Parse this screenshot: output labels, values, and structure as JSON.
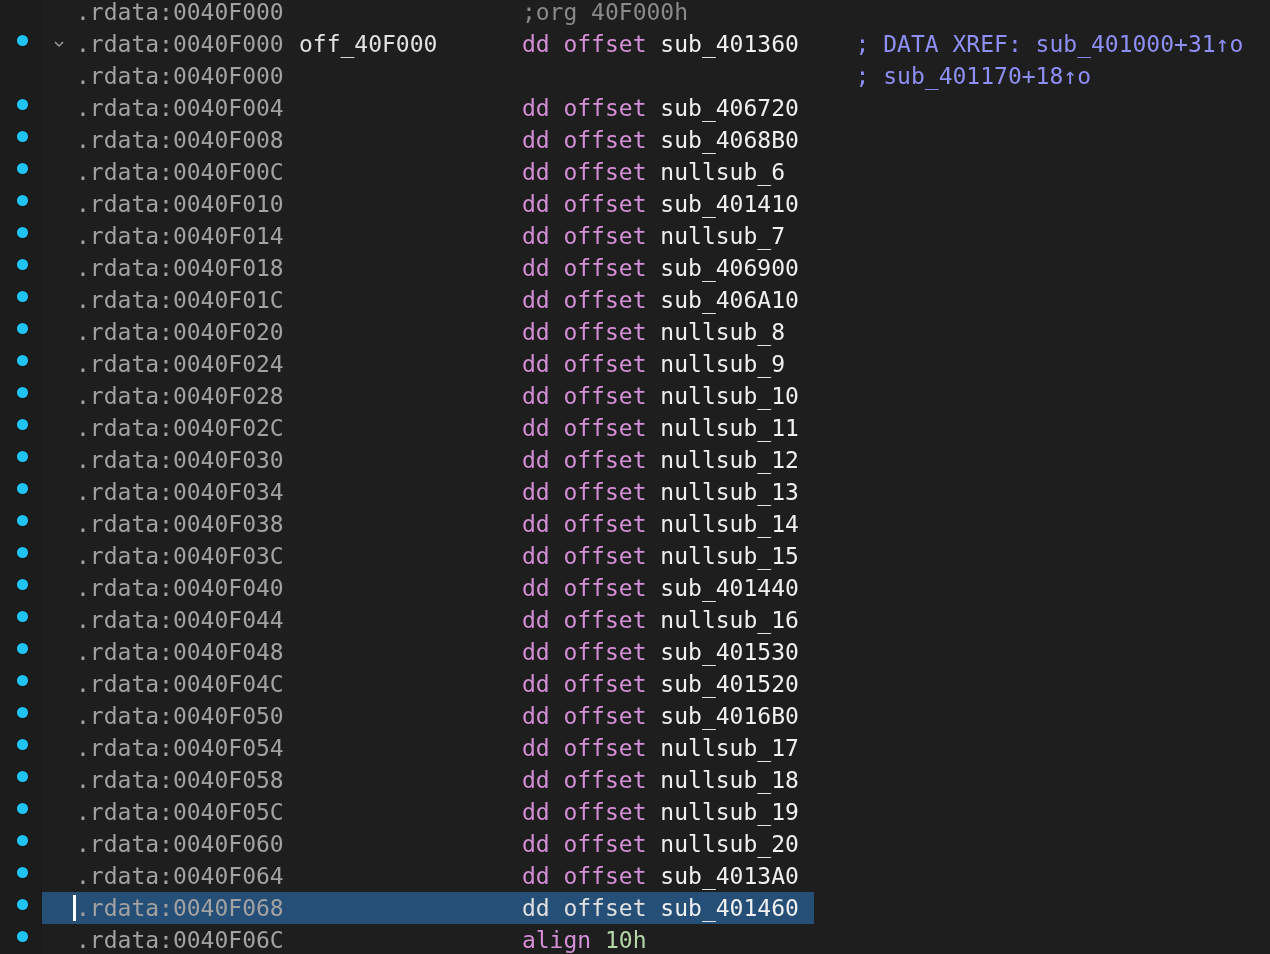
{
  "rows": [
    {
      "address": ".rdata:0040F000",
      "marked": false,
      "selected": false,
      "code": [
        {
          "kind": "directive",
          "text": ";org 40F000h"
        }
      ]
    },
    {
      "address": ".rdata:0040F000",
      "label": "off_40F000",
      "expanded": true,
      "marked": true,
      "selected": false,
      "code": [
        {
          "kind": "keyword",
          "text": "dd"
        },
        {
          "kind": "keyword",
          "text": "offset"
        },
        {
          "kind": "name",
          "text": "sub_401360"
        }
      ],
      "comment": "; DATA XREF: sub_401000+31↑o"
    },
    {
      "address": ".rdata:0040F000",
      "marked": false,
      "selected": false,
      "code": [],
      "comment": "; sub_401170+18↑o"
    },
    {
      "address": ".rdata:0040F004",
      "marked": true,
      "selected": false,
      "code": [
        {
          "kind": "keyword",
          "text": "dd"
        },
        {
          "kind": "keyword",
          "text": "offset"
        },
        {
          "kind": "name",
          "text": "sub_406720"
        }
      ]
    },
    {
      "address": ".rdata:0040F008",
      "marked": true,
      "selected": false,
      "code": [
        {
          "kind": "keyword",
          "text": "dd"
        },
        {
          "kind": "keyword",
          "text": "offset"
        },
        {
          "kind": "name",
          "text": "sub_4068B0"
        }
      ]
    },
    {
      "address": ".rdata:0040F00C",
      "marked": true,
      "selected": false,
      "code": [
        {
          "kind": "keyword",
          "text": "dd"
        },
        {
          "kind": "keyword",
          "text": "offset"
        },
        {
          "kind": "name",
          "text": "nullsub_6"
        }
      ]
    },
    {
      "address": ".rdata:0040F010",
      "marked": true,
      "selected": false,
      "code": [
        {
          "kind": "keyword",
          "text": "dd"
        },
        {
          "kind": "keyword",
          "text": "offset"
        },
        {
          "kind": "name",
          "text": "sub_401410"
        }
      ]
    },
    {
      "address": ".rdata:0040F014",
      "marked": true,
      "selected": false,
      "code": [
        {
          "kind": "keyword",
          "text": "dd"
        },
        {
          "kind": "keyword",
          "text": "offset"
        },
        {
          "kind": "name",
          "text": "nullsub_7"
        }
      ]
    },
    {
      "address": ".rdata:0040F018",
      "marked": true,
      "selected": false,
      "code": [
        {
          "kind": "keyword",
          "text": "dd"
        },
        {
          "kind": "keyword",
          "text": "offset"
        },
        {
          "kind": "name",
          "text": "sub_406900"
        }
      ]
    },
    {
      "address": ".rdata:0040F01C",
      "marked": true,
      "selected": false,
      "code": [
        {
          "kind": "keyword",
          "text": "dd"
        },
        {
          "kind": "keyword",
          "text": "offset"
        },
        {
          "kind": "name",
          "text": "sub_406A10"
        }
      ]
    },
    {
      "address": ".rdata:0040F020",
      "marked": true,
      "selected": false,
      "code": [
        {
          "kind": "keyword",
          "text": "dd"
        },
        {
          "kind": "keyword",
          "text": "offset"
        },
        {
          "kind": "name",
          "text": "nullsub_8"
        }
      ]
    },
    {
      "address": ".rdata:0040F024",
      "marked": true,
      "selected": false,
      "code": [
        {
          "kind": "keyword",
          "text": "dd"
        },
        {
          "kind": "keyword",
          "text": "offset"
        },
        {
          "kind": "name",
          "text": "nullsub_9"
        }
      ]
    },
    {
      "address": ".rdata:0040F028",
      "marked": true,
      "selected": false,
      "code": [
        {
          "kind": "keyword",
          "text": "dd"
        },
        {
          "kind": "keyword",
          "text": "offset"
        },
        {
          "kind": "name",
          "text": "nullsub_10"
        }
      ]
    },
    {
      "address": ".rdata:0040F02C",
      "marked": true,
      "selected": false,
      "code": [
        {
          "kind": "keyword",
          "text": "dd"
        },
        {
          "kind": "keyword",
          "text": "offset"
        },
        {
          "kind": "name",
          "text": "nullsub_11"
        }
      ]
    },
    {
      "address": ".rdata:0040F030",
      "marked": true,
      "selected": false,
      "code": [
        {
          "kind": "keyword",
          "text": "dd"
        },
        {
          "kind": "keyword",
          "text": "offset"
        },
        {
          "kind": "name",
          "text": "nullsub_12"
        }
      ]
    },
    {
      "address": ".rdata:0040F034",
      "marked": true,
      "selected": false,
      "code": [
        {
          "kind": "keyword",
          "text": "dd"
        },
        {
          "kind": "keyword",
          "text": "offset"
        },
        {
          "kind": "name",
          "text": "nullsub_13"
        }
      ]
    },
    {
      "address": ".rdata:0040F038",
      "marked": true,
      "selected": false,
      "code": [
        {
          "kind": "keyword",
          "text": "dd"
        },
        {
          "kind": "keyword",
          "text": "offset"
        },
        {
          "kind": "name",
          "text": "nullsub_14"
        }
      ]
    },
    {
      "address": ".rdata:0040F03C",
      "marked": true,
      "selected": false,
      "code": [
        {
          "kind": "keyword",
          "text": "dd"
        },
        {
          "kind": "keyword",
          "text": "offset"
        },
        {
          "kind": "name",
          "text": "nullsub_15"
        }
      ]
    },
    {
      "address": ".rdata:0040F040",
      "marked": true,
      "selected": false,
      "code": [
        {
          "kind": "keyword",
          "text": "dd"
        },
        {
          "kind": "keyword",
          "text": "offset"
        },
        {
          "kind": "name",
          "text": "sub_401440"
        }
      ]
    },
    {
      "address": ".rdata:0040F044",
      "marked": true,
      "selected": false,
      "code": [
        {
          "kind": "keyword",
          "text": "dd"
        },
        {
          "kind": "keyword",
          "text": "offset"
        },
        {
          "kind": "name",
          "text": "nullsub_16"
        }
      ]
    },
    {
      "address": ".rdata:0040F048",
      "marked": true,
      "selected": false,
      "code": [
        {
          "kind": "keyword",
          "text": "dd"
        },
        {
          "kind": "keyword",
          "text": "offset"
        },
        {
          "kind": "name",
          "text": "sub_401530"
        }
      ]
    },
    {
      "address": ".rdata:0040F04C",
      "marked": true,
      "selected": false,
      "code": [
        {
          "kind": "keyword",
          "text": "dd"
        },
        {
          "kind": "keyword",
          "text": "offset"
        },
        {
          "kind": "name",
          "text": "sub_401520"
        }
      ]
    },
    {
      "address": ".rdata:0040F050",
      "marked": true,
      "selected": false,
      "code": [
        {
          "kind": "keyword",
          "text": "dd"
        },
        {
          "kind": "keyword",
          "text": "offset"
        },
        {
          "kind": "name",
          "text": "sub_4016B0"
        }
      ]
    },
    {
      "address": ".rdata:0040F054",
      "marked": true,
      "selected": false,
      "code": [
        {
          "kind": "keyword",
          "text": "dd"
        },
        {
          "kind": "keyword",
          "text": "offset"
        },
        {
          "kind": "name",
          "text": "nullsub_17"
        }
      ]
    },
    {
      "address": ".rdata:0040F058",
      "marked": true,
      "selected": false,
      "code": [
        {
          "kind": "keyword",
          "text": "dd"
        },
        {
          "kind": "keyword",
          "text": "offset"
        },
        {
          "kind": "name",
          "text": "nullsub_18"
        }
      ]
    },
    {
      "address": ".rdata:0040F05C",
      "marked": true,
      "selected": false,
      "code": [
        {
          "kind": "keyword",
          "text": "dd"
        },
        {
          "kind": "keyword",
          "text": "offset"
        },
        {
          "kind": "name",
          "text": "nullsub_19"
        }
      ]
    },
    {
      "address": ".rdata:0040F060",
      "marked": true,
      "selected": false,
      "code": [
        {
          "kind": "keyword",
          "text": "dd"
        },
        {
          "kind": "keyword",
          "text": "offset"
        },
        {
          "kind": "name",
          "text": "nullsub_20"
        }
      ]
    },
    {
      "address": ".rdata:0040F064",
      "marked": true,
      "selected": false,
      "code": [
        {
          "kind": "keyword",
          "text": "dd"
        },
        {
          "kind": "keyword",
          "text": "offset"
        },
        {
          "kind": "name",
          "text": "sub_4013A0"
        }
      ]
    },
    {
      "address": ".rdata:0040F068",
      "marked": true,
      "selected": true,
      "code": [
        {
          "kind": "keyword",
          "text": "dd"
        },
        {
          "kind": "keyword",
          "text": "offset"
        },
        {
          "kind": "name",
          "text": "sub_401460"
        }
      ]
    },
    {
      "address": ".rdata:0040F06C",
      "marked": true,
      "selected": false,
      "code": [
        {
          "kind": "keyword",
          "text": "align"
        },
        {
          "kind": "number",
          "text": "10h"
        }
      ]
    }
  ]
}
